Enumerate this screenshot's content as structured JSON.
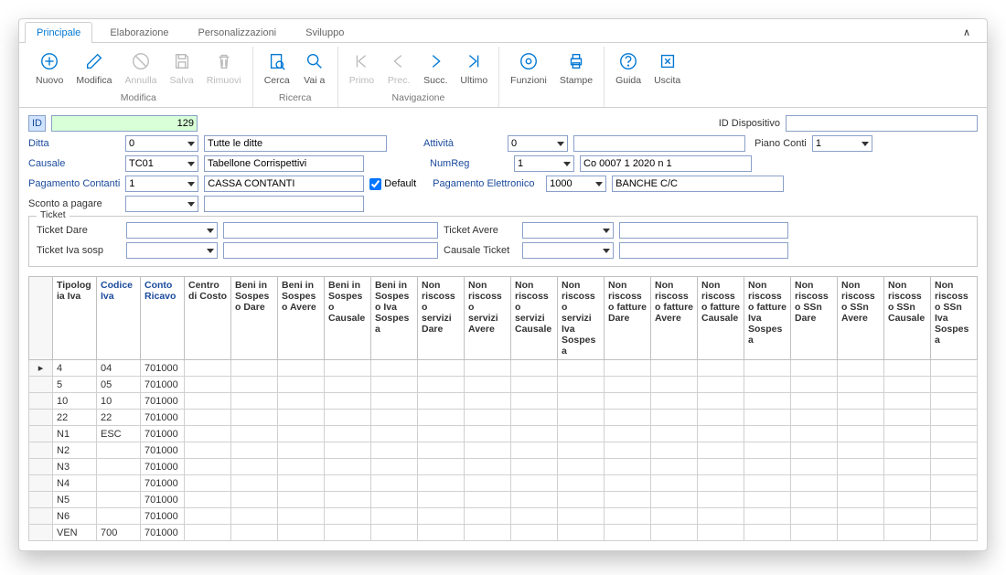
{
  "tabs": [
    "Principale",
    "Elaborazione",
    "Personalizzazioni",
    "Sviluppo"
  ],
  "ribbon": {
    "groups": [
      {
        "label": "Modifica",
        "buttons": [
          {
            "key": "nuovo",
            "label": "Nuovo",
            "disabled": false
          },
          {
            "key": "modifica",
            "label": "Modifica",
            "disabled": false
          },
          {
            "key": "annulla",
            "label": "Annulla",
            "disabled": true
          },
          {
            "key": "salva",
            "label": "Salva",
            "disabled": true
          },
          {
            "key": "rimuovi",
            "label": "Rimuovi",
            "disabled": true
          }
        ]
      },
      {
        "label": "Ricerca",
        "buttons": [
          {
            "key": "cerca",
            "label": "Cerca",
            "disabled": false
          },
          {
            "key": "vaia",
            "label": "Vai a",
            "disabled": false
          }
        ]
      },
      {
        "label": "Navigazione",
        "buttons": [
          {
            "key": "primo",
            "label": "Primo",
            "disabled": true
          },
          {
            "key": "prec",
            "label": "Prec.",
            "disabled": true
          },
          {
            "key": "succ",
            "label": "Succ.",
            "disabled": false
          },
          {
            "key": "ultimo",
            "label": "Ultimo",
            "disabled": false
          }
        ]
      },
      {
        "label": "",
        "buttons": [
          {
            "key": "funzioni",
            "label": "Funzioni",
            "disabled": false
          },
          {
            "key": "stampe",
            "label": "Stampe",
            "disabled": false
          }
        ]
      },
      {
        "label": "",
        "buttons": [
          {
            "key": "guida",
            "label": "Guida",
            "disabled": false
          },
          {
            "key": "uscita",
            "label": "Uscita",
            "disabled": false
          }
        ]
      }
    ]
  },
  "form": {
    "id_label": "ID",
    "id_value": "129",
    "id_dispositivo_label": "ID Dispositivo",
    "id_dispositivo_value": "",
    "ditta_label": "Ditta",
    "ditta_value": "0",
    "ditta_desc": "Tutte le ditte",
    "attivita_label": "Attività",
    "attivita_value": "0",
    "attivita_desc": "",
    "piano_conti_label": "Piano Conti",
    "piano_conti_value": "1",
    "causale_label": "Causale",
    "causale_value": "TC01",
    "causale_desc": "Tabellone Corrispettivi",
    "numreg_label": "NumReg",
    "numreg_value": "1",
    "numreg_desc": "Co 0007 1 2020 n 1",
    "pag_contanti_label": "Pagamento Contanti",
    "pag_contanti_value": "1",
    "pag_contanti_desc": "CASSA CONTANTI",
    "default_label": "Default",
    "pag_elettr_label": "Pagamento Elettronico",
    "pag_elettr_value": "1000",
    "pag_elettr_desc": "BANCHE C/C",
    "sconto_label": "Sconto a pagare",
    "sconto_value": "",
    "sconto_desc": "",
    "ticket_legend": "Ticket",
    "ticket_dare_label": "Ticket Dare",
    "ticket_avere_label": "Ticket Avere",
    "ticket_iva_label": "Ticket Iva sosp",
    "causale_ticket_label": "Causale Ticket"
  },
  "grid": {
    "headers": [
      "Tipologia Iva",
      "Codice Iva",
      "Conto Ricavo",
      "Centro di Costo",
      "Beni in Sospeso Dare",
      "Beni in Sospeso Avere",
      "Beni in Sospeso Causale",
      "Beni in Sospeso Iva Sospesa",
      "Non riscosso servizi Dare",
      "Non riscosso servizi Avere",
      "Non riscosso servizi Causale",
      "Non riscosso servizi Iva Sospesa",
      "Non riscosso fatture Dare",
      "Non riscosso fatture Avere",
      "Non riscosso fatture Causale",
      "Non riscosso fatture Iva Sospesa",
      "Non riscosso SSn Dare",
      "Non riscosso SSn Avere",
      "Non riscosso SSn Causale",
      "Non riscosso SSn Iva Sospesa"
    ],
    "link_cols": [
      1,
      2
    ],
    "rows": [
      {
        "ind": "▸",
        "cells": [
          "4",
          "04",
          "701000",
          "",
          "",
          "",
          "",
          "",
          "",
          "",
          "",
          "",
          "",
          "",
          "",
          "",
          "",
          "",
          "",
          ""
        ]
      },
      {
        "ind": "",
        "cells": [
          "5",
          "05",
          "701000",
          "",
          "",
          "",
          "",
          "",
          "",
          "",
          "",
          "",
          "",
          "",
          "",
          "",
          "",
          "",
          "",
          ""
        ]
      },
      {
        "ind": "",
        "cells": [
          "10",
          "10",
          "701000",
          "",
          "",
          "",
          "",
          "",
          "",
          "",
          "",
          "",
          "",
          "",
          "",
          "",
          "",
          "",
          "",
          ""
        ]
      },
      {
        "ind": "",
        "cells": [
          "22",
          "22",
          "701000",
          "",
          "",
          "",
          "",
          "",
          "",
          "",
          "",
          "",
          "",
          "",
          "",
          "",
          "",
          "",
          "",
          ""
        ]
      },
      {
        "ind": "",
        "cells": [
          "N1",
          "ESC",
          "701000",
          "",
          "",
          "",
          "",
          "",
          "",
          "",
          "",
          "",
          "",
          "",
          "",
          "",
          "",
          "",
          "",
          ""
        ]
      },
      {
        "ind": "",
        "cells": [
          "N2",
          "",
          "701000",
          "",
          "",
          "",
          "",
          "",
          "",
          "",
          "",
          "",
          "",
          "",
          "",
          "",
          "",
          "",
          "",
          ""
        ]
      },
      {
        "ind": "",
        "cells": [
          "N3",
          "",
          "701000",
          "",
          "",
          "",
          "",
          "",
          "",
          "",
          "",
          "",
          "",
          "",
          "",
          "",
          "",
          "",
          "",
          ""
        ]
      },
      {
        "ind": "",
        "cells": [
          "N4",
          "",
          "701000",
          "",
          "",
          "",
          "",
          "",
          "",
          "",
          "",
          "",
          "",
          "",
          "",
          "",
          "",
          "",
          "",
          ""
        ]
      },
      {
        "ind": "",
        "cells": [
          "N5",
          "",
          "701000",
          "",
          "",
          "",
          "",
          "",
          "",
          "",
          "",
          "",
          "",
          "",
          "",
          "",
          "",
          "",
          "",
          ""
        ]
      },
      {
        "ind": "",
        "cells": [
          "N6",
          "",
          "701000",
          "",
          "",
          "",
          "",
          "",
          "",
          "",
          "",
          "",
          "",
          "",
          "",
          "",
          "",
          "",
          "",
          ""
        ]
      },
      {
        "ind": "",
        "cells": [
          "VEN",
          "700",
          "701000",
          "",
          "",
          "",
          "",
          "",
          "",
          "",
          "",
          "",
          "",
          "",
          "",
          "",
          "",
          "",
          "",
          ""
        ]
      }
    ]
  }
}
